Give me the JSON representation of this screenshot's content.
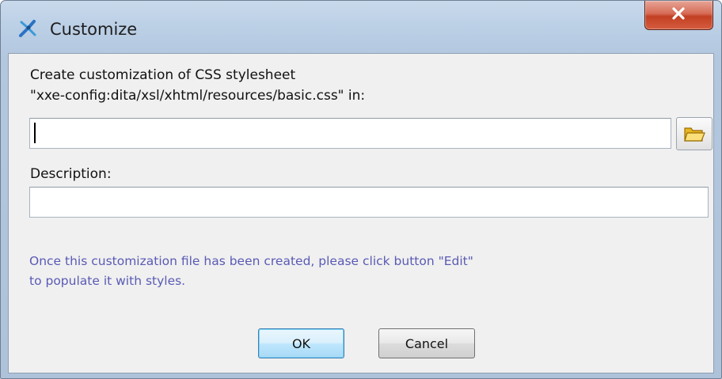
{
  "window": {
    "title": "Customize",
    "icon": "xxe-app-icon",
    "close_icon": "close-x-icon"
  },
  "form": {
    "intro_line1": "Create customization of CSS stylesheet",
    "intro_line2": "\"xxe-config:dita/xsl/xhtml/resources/basic.css\" in:",
    "location_value": "",
    "folder_icon": "folder-icon",
    "description_label": "Description:",
    "description_value": "",
    "info_line1": "Once this customization file has been created, please click button \"Edit\"",
    "info_line2": "to populate it with styles."
  },
  "buttons": {
    "ok": "OK",
    "cancel": "Cancel"
  },
  "colors": {
    "info_text": "#5a5ab5",
    "close_button": "#c94a2c",
    "default_button_border": "#3c7fb1"
  }
}
